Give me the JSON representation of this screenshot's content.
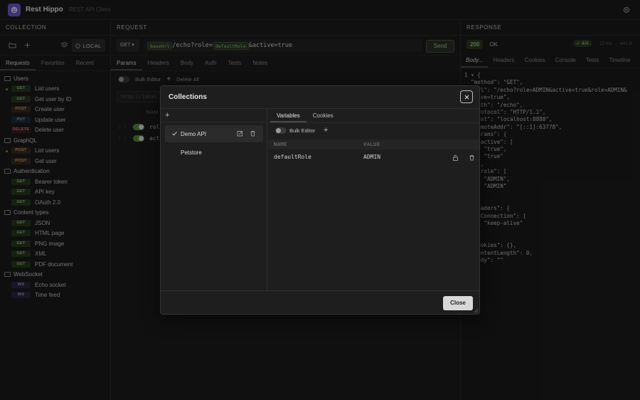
{
  "app": {
    "title": "Rest Hippo",
    "subtitle": "REST API Client"
  },
  "collection": {
    "title": "COLLECTION",
    "env_label": "LOCAL",
    "tabs": [
      "Requests",
      "Favorites",
      "Recent"
    ],
    "folders": [
      {
        "name": "Users",
        "items": [
          {
            "method": "GET",
            "label": "List users",
            "dot": true
          },
          {
            "method": "GET",
            "label": "Get user by ID"
          },
          {
            "method": "POST",
            "label": "Create user"
          },
          {
            "method": "PUT",
            "label": "Update user"
          },
          {
            "method": "DELETE",
            "label": "Delete user"
          }
        ]
      },
      {
        "name": "GraphQL",
        "items": [
          {
            "method": "POST",
            "label": "List users",
            "dot": true
          },
          {
            "method": "POST",
            "label": "Get user"
          }
        ]
      },
      {
        "name": "Authentication",
        "items": [
          {
            "method": "GET",
            "label": "Bearer token"
          },
          {
            "method": "GET",
            "label": "API key"
          },
          {
            "method": "GET",
            "label": "OAuth 2.0"
          }
        ]
      },
      {
        "name": "Content types",
        "items": [
          {
            "method": "GET",
            "label": "JSON"
          },
          {
            "method": "GET",
            "label": "HTML page"
          },
          {
            "method": "GET",
            "label": "PNG image"
          },
          {
            "method": "GET",
            "label": "XML"
          },
          {
            "method": "GET",
            "label": "PDF document"
          }
        ]
      },
      {
        "name": "WebSocket",
        "items": [
          {
            "method": "WS",
            "label": "Echo socket"
          },
          {
            "method": "WS",
            "label": "Time feed"
          }
        ]
      }
    ]
  },
  "request": {
    "title": "REQUEST",
    "method": "GET",
    "url": {
      "var1": "baseUrl",
      "path": "/echo?role=",
      "var2": "defaultRole",
      "rest": "&active=true"
    },
    "send_label": "Send",
    "tabs": [
      "Params",
      "Headers",
      "Body",
      "Auth",
      "Tests",
      "Notes"
    ],
    "bulk_editor_label": "Bulk Editor",
    "delete_all_label": "Delete All",
    "bulk_placeholder": "http://local",
    "params_header": "NAM",
    "params": [
      "role",
      "acti"
    ]
  },
  "response": {
    "title": "RESPONSE",
    "status_code": "200",
    "status_text": "OK",
    "tests_badge": "✓ 4/4",
    "time": "12 ms",
    "size": "441 B",
    "tabs": [
      "Body...",
      "Headers",
      "Cookies",
      "Console",
      "Tests",
      "Timeline"
    ],
    "body_lines": [
      "1 ▾ {",
      "  \"method\": \"GET\",",
      "  \"url\": \"/echo?role=ADMIN&active=true&role=ADMIN&",
      "  ctive=true\",",
      "  \"path\": \"/echo\",",
      "  \"protocol\": \"HTTP/1.1\",",
      "  \"host\": \"localhost:8888\",",
      "  \"remoteAddr\": \"[::1]:63778\",",
      "  \"params\": {",
      "    \"active\": [",
      "      \"true\",",
      "      \"true\"",
      "    ],",
      "    \"role\": [",
      "      \"ADMIN\",",
      "      \"ADMIN\"",
      "    ]",
      "  },",
      "  \"headers\": {",
      "    \"Connection\": [",
      "      \"keep-alive\"",
      "    ]",
      "  },",
      "  \"cookies\": {},",
      "  \"contentLength\": 0,",
      "  \"body\": \"\""
    ]
  },
  "modal": {
    "title": "Collections",
    "collections": [
      "Demo API",
      "Petstore"
    ],
    "tabs": [
      "Variables",
      "Cookies"
    ],
    "bulk_editor_label": "Bulk Editor",
    "col_name": "NAME",
    "col_value": "VALUE",
    "variable": {
      "name": "defaultRole",
      "value": "ADMIN"
    },
    "close_label": "Close"
  },
  "colors": {
    "accent": "#6a5acd",
    "success": "#9ac27a",
    "toggle_on": "#5b8a3c"
  }
}
